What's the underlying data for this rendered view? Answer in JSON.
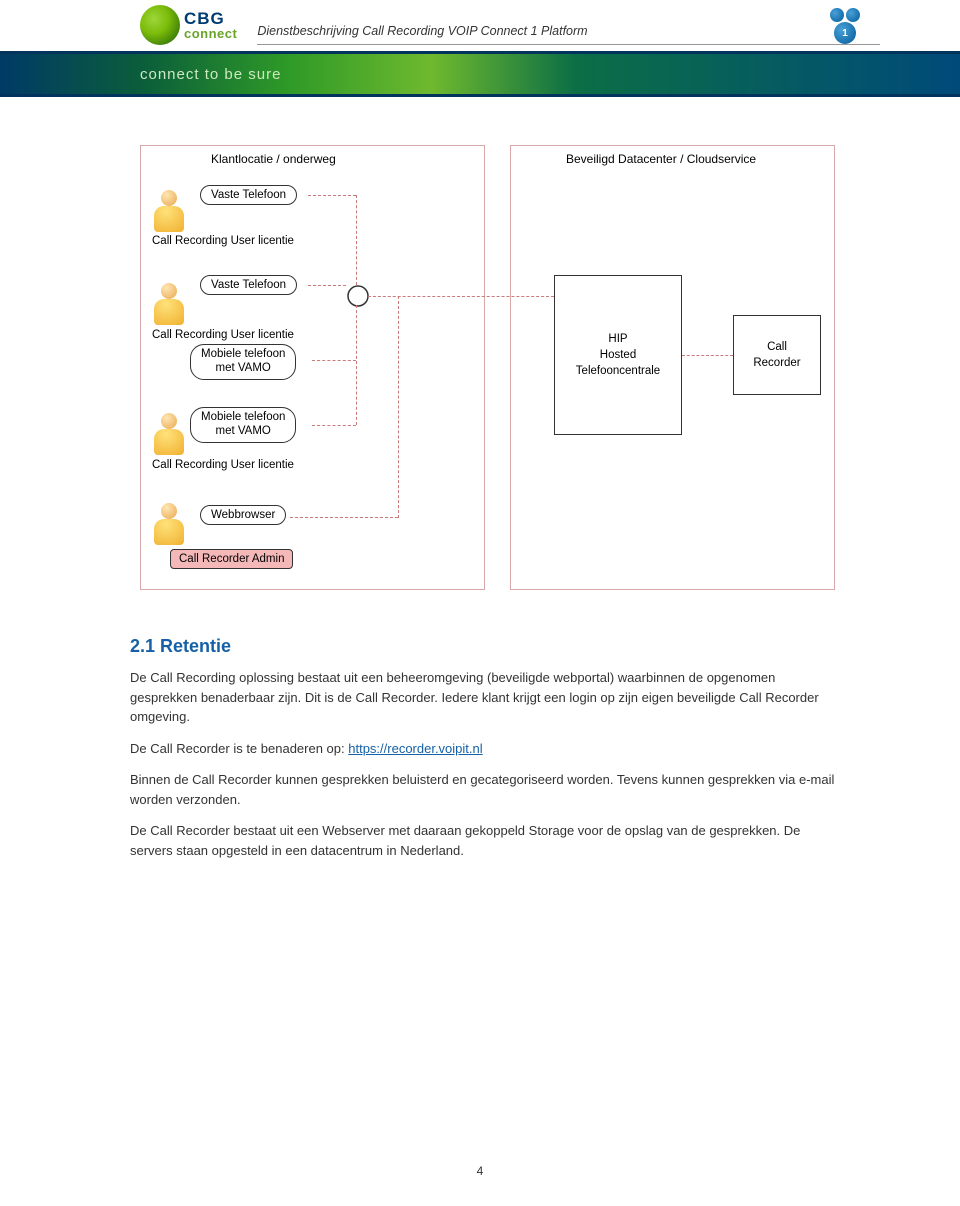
{
  "header": {
    "logo_top": "CBG",
    "logo_bottom": "connect",
    "doc_title": "Dienstbeschrijving Call Recording VOIP Connect 1 Platform",
    "badge_number": "1",
    "banner_tagline": "connect to be sure"
  },
  "diagram": {
    "zones": {
      "left_title": "Klantlocatie / onderweg",
      "right_title": "Beveiligd Datacenter / Cloudservice"
    },
    "group1": {
      "bubble": "Vaste Telefoon",
      "caption": "Call Recording User licentie"
    },
    "group2": {
      "bubble1": "Vaste Telefoon",
      "caption1": "Call Recording User licentie",
      "bubble2": "Mobiele telefoon",
      "bubble2b": "met VAMO"
    },
    "group3": {
      "bubble": "Mobiele telefoon",
      "bubble_b": "met VAMO",
      "caption": "Call Recording User licentie"
    },
    "group4": {
      "bubble": "Webbrowser",
      "badge": "Call Recorder Admin"
    },
    "hip": {
      "line1": "HIP",
      "line2": "Hosted",
      "line3": "Telefooncentrale"
    },
    "recorder": {
      "line1": "Call",
      "line2": "Recorder"
    }
  },
  "section": {
    "heading": "2.1 Retentie",
    "p1": "De Call Recording oplossing bestaat uit een beheeromgeving (beveiligde webportal) waarbinnen de opgenomen gesprekken benaderbaar zijn. Dit is de Call Recorder. Iedere klant krijgt een login op zijn eigen beveiligde Call Recorder omgeving.",
    "p2_a": "De Call Recorder is te benaderen op: ",
    "p2_link": "https://recorder.voipit.nl",
    "p3": "Binnen de Call Recorder kunnen gesprekken beluisterd en gecategoriseerd worden. Tevens kunnen gesprekken via e-mail worden verzonden.",
    "p4": "De Call Recorder bestaat uit een Webserver met daaraan gekoppeld Storage voor de opslag van de gesprekken. De servers staan opgesteld in een datacentrum in Nederland."
  },
  "page_number": "4"
}
